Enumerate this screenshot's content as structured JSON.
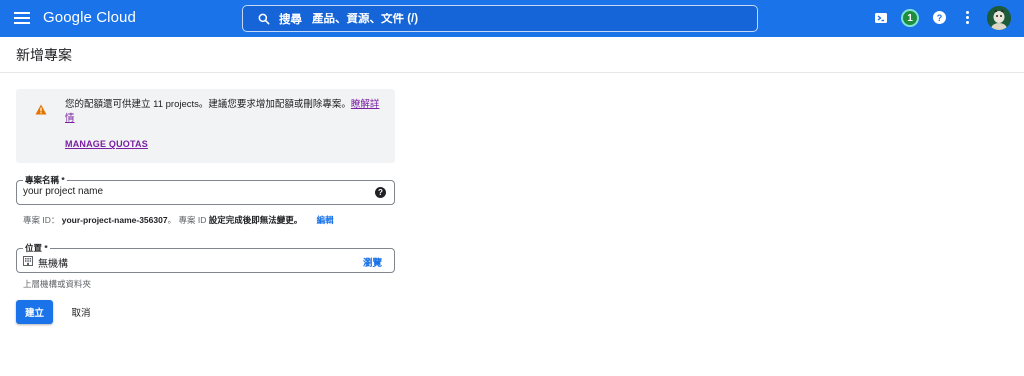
{
  "header": {
    "brand": "Google Cloud",
    "search_label": "搜尋",
    "search_placeholder": "產品、資源、文件 (/)",
    "notification_count": "1",
    "help_glyph": "?",
    "accent_color": "#1a73e8"
  },
  "page": {
    "title": "新增專案"
  },
  "warning": {
    "message": "您的配額還可供建立 11 projects。建議您要求增加配額或刪除專案。",
    "learn_more": "瞭解詳情",
    "manage_quotas": "MANAGE QUOTAS",
    "icon": "warning-triangle-icon"
  },
  "form": {
    "project_name": {
      "label": "專案名稱 *",
      "value": "your project name"
    },
    "project_id": {
      "prefix": "專案 ID：",
      "value": "your-project-name-356307",
      "separator": "。",
      "note_prefix": "專案 ID",
      "note": "設定完成後即無法變更。",
      "edit": "編輯"
    },
    "location": {
      "label": "位置 *",
      "value": "無機構",
      "browse": "瀏覽",
      "helper": "上層機構或資料夾"
    }
  },
  "actions": {
    "create": "建立",
    "cancel": "取消"
  }
}
